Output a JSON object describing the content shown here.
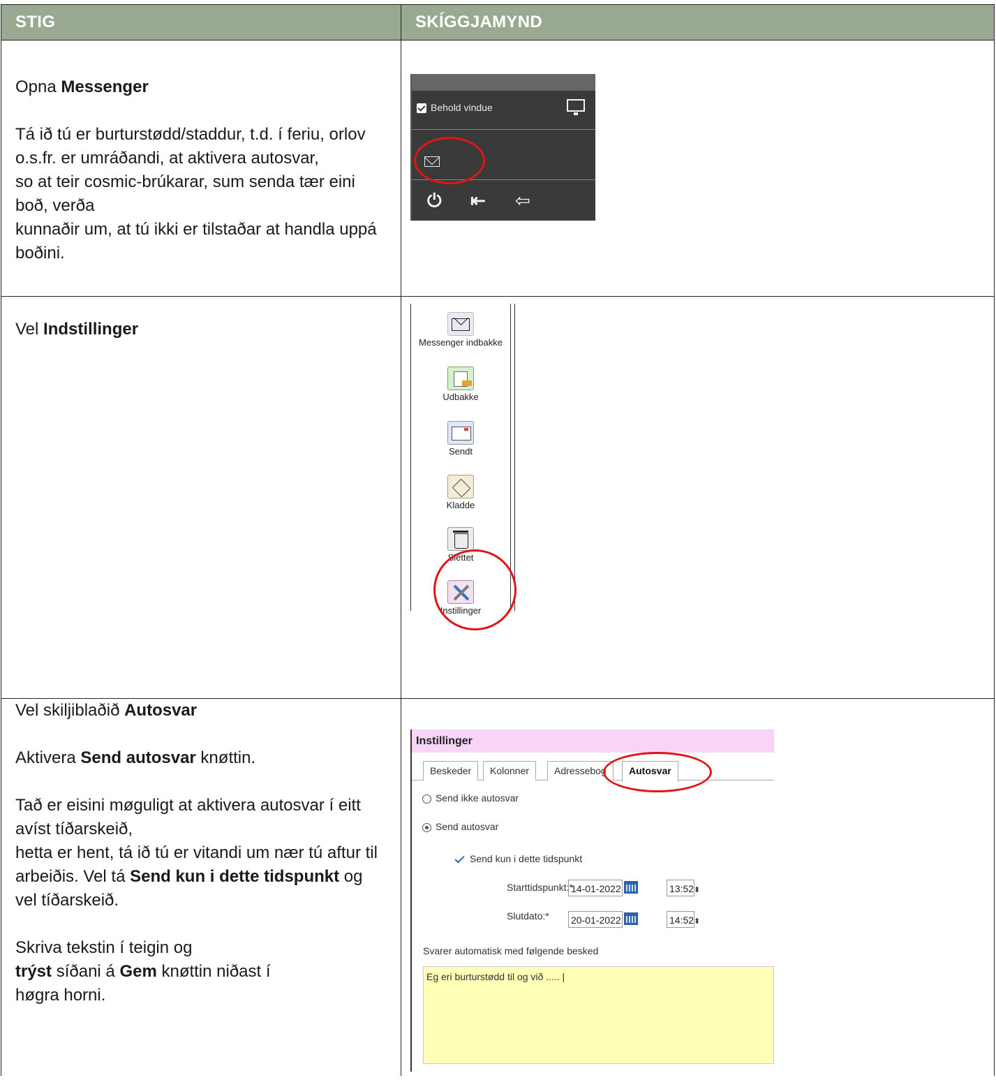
{
  "header": {
    "col1": "STIG",
    "col2": "SKÍGGJAMYND"
  },
  "rows": [
    {
      "paragraphs": [
        [
          "Opna ",
          "Messenger"
        ],
        [
          "Tá ið tú er burturstødd/staddur, t.d. í feriu, orlov o.s.fr. er umráðandi, at aktivera autosvar,",
          "so at teir cosmic-brúkarar, sum senda tær eini boð, verða",
          "kunnaðir um, at tú ikki er tilstaðar at handla uppá boðini."
        ]
      ]
    },
    {
      "text_plain": "Vel ",
      "text_bold": "Indstillinger"
    },
    {
      "line1_plain": "Vel skiljiblaðið ",
      "line1_bold": "Autosvar",
      "line2_plain": "Aktivera ",
      "line2_bold": "Send autosvar",
      "line2_tail": " knøttin.",
      "para3_a": "Tað er eisini møguligt at aktivera autosvar í eitt avíst tíðarskeið,",
      "para3_b": "hetta er hent, tá ið tú er vitandi um nær tú aftur til arbeiðis. Vel tá ",
      "para3_bold": "Send kun i dette tidspunkt",
      "para3_tail": " og vel tíðarskeið.",
      "para4_a": "Skriva tekstin í teigin og",
      "para4_bold1": "trýst",
      "para4_mid": " síðani á ",
      "para4_bold2": "Gem",
      "para4_tail": " knøttin niðast í",
      "para4_last": "høgra horni."
    }
  ],
  "screenshot1": {
    "checkbox_label": "Behold vindue",
    "icons": [
      "checkbox-icon",
      "monitor-icon",
      "envelope-icon",
      "power-icon",
      "logout-icon",
      "logout-outline-icon"
    ],
    "power_glyph": "⏻",
    "logout_glyph": "⇤",
    "logout2_glyph": "⇦"
  },
  "screenshot2": {
    "items": [
      {
        "label": "Messenger indbakke",
        "icon": "envelope-icon"
      },
      {
        "label": "Udbakke",
        "icon": "outbox-icon"
      },
      {
        "label": "Sendt",
        "icon": "sent-icon"
      },
      {
        "label": "Kladde",
        "icon": "draft-icon"
      },
      {
        "label": "Slettet",
        "icon": "trash-icon"
      },
      {
        "label": "Instillinger",
        "icon": "tools-icon"
      }
    ]
  },
  "screenshot3": {
    "title": "Instillinger",
    "tabs": [
      "Beskeder",
      "Kolonner",
      "Adressebog",
      "Autosvar"
    ],
    "active_tab": "Autosvar",
    "radio_off": "Send ikke autosvar",
    "radio_on": "Send autosvar",
    "checkbox_label": "Send kun i dette tidspunkt",
    "start_label": "Starttidspunkt:*",
    "start_date": "14-01-2022",
    "start_time": "13:52",
    "end_label": "Slutdato:*",
    "end_date": "20-01-2022",
    "end_time": "14:52",
    "message_label": "Svarer automatisk med følgende besked",
    "message_value": "Eg eri burturstødd til og við ..... |",
    "spin_glyph": "⬍"
  },
  "colors": {
    "header_bg": "#9aaa92",
    "highlight": "#e01515",
    "dialog_title_bg": "#f8d4f8",
    "message_bg": "#ffffb8"
  }
}
